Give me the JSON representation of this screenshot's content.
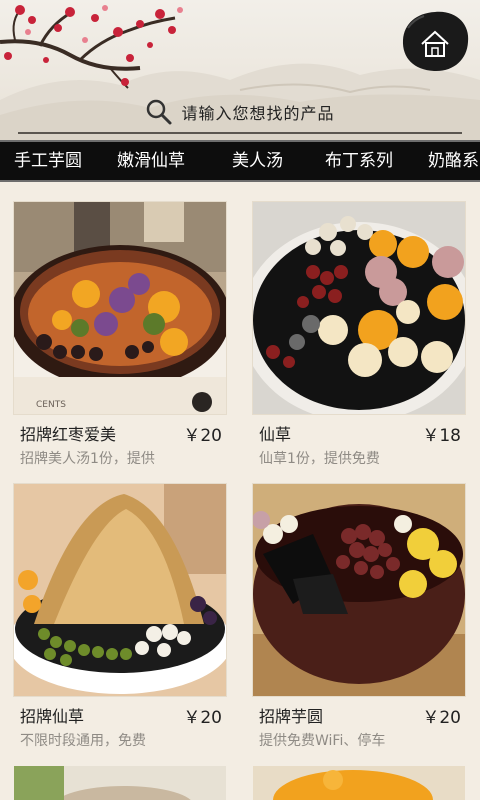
{
  "header": {
    "search_placeholder": "请输入您想找的产品"
  },
  "nav": {
    "tabs": [
      "手工芋圆",
      "嫩滑仙草",
      "美人汤",
      "布丁系列",
      "奶酪系"
    ]
  },
  "products": [
    {
      "name": "招牌红枣爱美",
      "price": "￥20",
      "desc": "招牌美人汤1份，提供",
      "photo_caption": "CENTS"
    },
    {
      "name": "仙草",
      "price": "￥18",
      "desc": "仙草1份，提供免费"
    },
    {
      "name": "招牌仙草",
      "price": "￥20",
      "desc": "不限时段通用，免费"
    },
    {
      "name": "招牌芋圆",
      "price": "￥20",
      "desc": "提供免费WiFi、停车"
    }
  ],
  "colors": {
    "nav_bg": "#0d0d0d",
    "page_bg": "#f3ede3",
    "desc_text": "#8f8b85"
  },
  "icons": {
    "home": "home-icon",
    "search": "search-icon"
  }
}
